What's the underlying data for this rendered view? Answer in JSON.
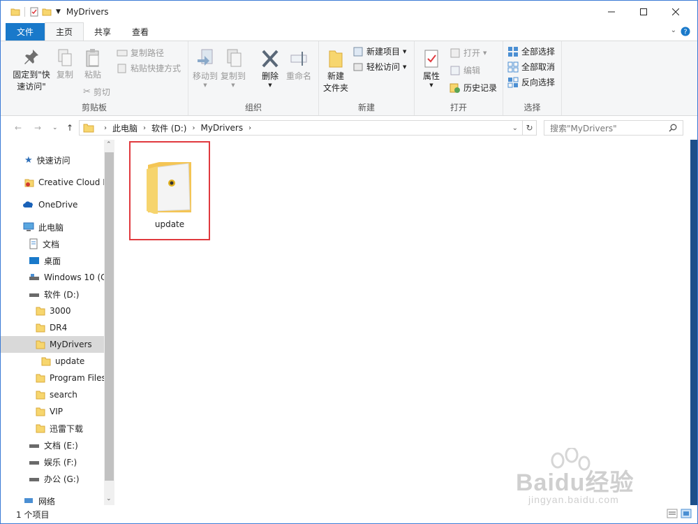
{
  "window": {
    "title": "MyDrivers"
  },
  "tabs": [
    {
      "label": "文件"
    },
    {
      "label": "主页"
    },
    {
      "label": "共享"
    },
    {
      "label": "查看"
    }
  ],
  "ribbon": {
    "clipboard": {
      "pin_line1": "固定到\"快",
      "pin_line2": "速访问\"",
      "copy": "复制",
      "paste": "粘贴",
      "copy_path": "复制路径",
      "paste_shortcut": "粘贴快捷方式",
      "cut": "剪切",
      "group": "剪贴板"
    },
    "organize": {
      "move_to": "移动到",
      "copy_to": "复制到",
      "delete": "删除",
      "rename": "重命名",
      "group": "组织"
    },
    "new": {
      "new_folder_line1": "新建",
      "new_folder_line2": "文件夹",
      "new_item": "新建项目",
      "easy_access": "轻松访问",
      "group": "新建"
    },
    "open": {
      "properties": "属性",
      "open": "打开",
      "edit": "编辑",
      "history": "历史记录",
      "group": "打开"
    },
    "select": {
      "select_all": "全部选择",
      "select_none": "全部取消",
      "invert": "反向选择",
      "group": "选择"
    }
  },
  "address": {
    "crumbs": [
      "此电脑",
      "软件 (D:)",
      "MyDrivers"
    ],
    "search_placeholder": "搜索\"MyDrivers\""
  },
  "nav": [
    {
      "label": "快速访问",
      "icon": "star-icon"
    },
    {
      "label": "Creative Cloud F",
      "icon": "creative-cloud-icon"
    },
    {
      "label": "OneDrive",
      "icon": "onedrive-icon"
    },
    {
      "label": "此电脑",
      "icon": "computer-icon"
    },
    {
      "label": "文档",
      "icon": "document-icon"
    },
    {
      "label": "桌面",
      "icon": "desktop-icon"
    },
    {
      "label": "Windows 10 (C",
      "icon": "drive-icon"
    },
    {
      "label": "软件 (D:)",
      "icon": "drive-icon"
    },
    {
      "label": "3000",
      "icon": "folder-icon"
    },
    {
      "label": "DR4",
      "icon": "folder-icon"
    },
    {
      "label": "MyDrivers",
      "icon": "folder-icon"
    },
    {
      "label": "update",
      "icon": "folder-icon"
    },
    {
      "label": "Program Files",
      "icon": "folder-icon"
    },
    {
      "label": "search",
      "icon": "folder-icon"
    },
    {
      "label": "VIP",
      "icon": "folder-icon"
    },
    {
      "label": "迅雷下载",
      "icon": "folder-icon"
    },
    {
      "label": "文档 (E:)",
      "icon": "drive-icon"
    },
    {
      "label": "娱乐 (F:)",
      "icon": "drive-icon"
    },
    {
      "label": "办公 (G:)",
      "icon": "drive-icon"
    },
    {
      "label": "网络",
      "icon": "network-icon"
    }
  ],
  "content": {
    "items": [
      {
        "name": "update"
      }
    ]
  },
  "status": {
    "count": "1 个项目"
  },
  "watermark": {
    "brand": "Baidu经验",
    "url": "jingyan.baidu.com"
  }
}
